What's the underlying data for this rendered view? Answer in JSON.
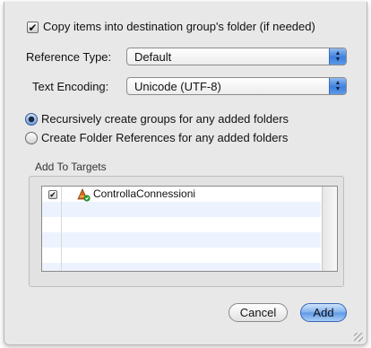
{
  "copy_items": {
    "label": "Copy items into destination group's folder (if needed)",
    "checked": true,
    "mark": "✔"
  },
  "reference_type": {
    "label": "Reference Type:",
    "value": "Default"
  },
  "text_encoding": {
    "label": "Text Encoding:",
    "value": "Unicode (UTF-8)"
  },
  "popup_arrows": {
    "up": "▲",
    "down": "▼"
  },
  "folder_options": [
    {
      "label": "Recursively create groups for any added folders",
      "selected": true
    },
    {
      "label": "Create Folder References for any added folders",
      "selected": false
    }
  ],
  "targets": {
    "title": "Add To Targets",
    "items": [
      {
        "name": "ControllaConnessioni",
        "checked": true,
        "mark": "✔",
        "icon": "app-target-icon"
      }
    ]
  },
  "buttons": {
    "cancel": "Cancel",
    "add": "Add"
  },
  "colors": {
    "accent": "#5e98e6",
    "stripe": "#edf3fe"
  }
}
